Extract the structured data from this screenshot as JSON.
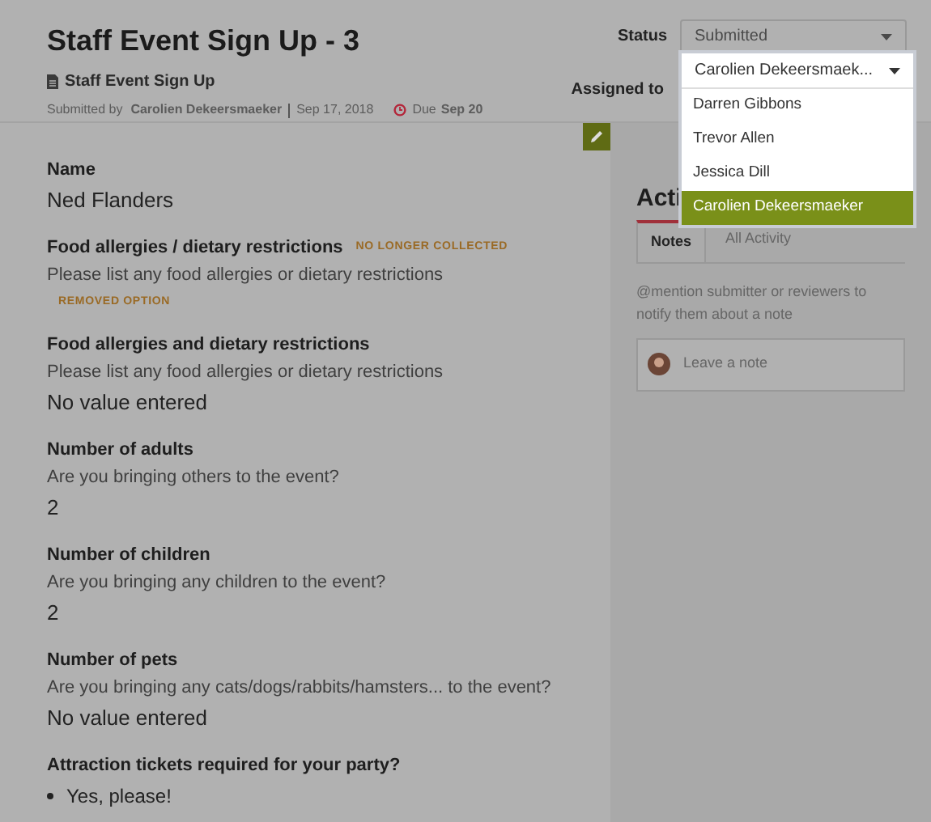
{
  "header": {
    "title": "Staff Event Sign Up - 3",
    "form_name": "Staff Event Sign Up",
    "submitted_by_label": "Submitted by",
    "submitter": "Carolien Dekeersmaeker",
    "date": "Sep 17, 2018",
    "due_label": "Due",
    "due_date": "Sep 20"
  },
  "status": {
    "label": "Status",
    "value": "Submitted"
  },
  "assigned": {
    "label": "Assigned to",
    "value": "Carolien Dekeersmaek...",
    "expanded": true,
    "options": [
      {
        "label": "Darren Gibbons",
        "selected": false
      },
      {
        "label": "Trevor Allen",
        "selected": false
      },
      {
        "label": "Jessica Dill",
        "selected": false
      },
      {
        "label": "Carolien Dekeersmaeker",
        "selected": true
      }
    ]
  },
  "fields": [
    {
      "label": "Name",
      "value": "Ned Flanders",
      "kind": "text"
    },
    {
      "label": "Food allergies / dietary restrictions",
      "badge": "NO LONGER COLLECTED",
      "description": "Please list any food allergies or dietary restrictions",
      "value": "REMOVED OPTION",
      "kind": "removed"
    },
    {
      "label": "Food allergies and dietary restrictions",
      "description": "Please list any food allergies or dietary restrictions",
      "value": "No value entered",
      "kind": "text"
    },
    {
      "label": "Number of adults",
      "description": "Are you bringing others to the event?",
      "value": "2",
      "kind": "text"
    },
    {
      "label": "Number of children",
      "description": "Are you bringing any children to the event?",
      "value": "2",
      "kind": "text"
    },
    {
      "label": "Number of pets",
      "description": "Are you bringing any cats/dogs/rabbits/hamsters... to the event?",
      "value": "No value entered",
      "kind": "text"
    },
    {
      "label": "Attraction tickets required for your party?",
      "value": "Yes, please!",
      "kind": "bullet"
    }
  ],
  "activity": {
    "title": "Acti",
    "tabs": [
      {
        "label": "Notes",
        "selected": true
      },
      {
        "label": "All Activity",
        "selected": false
      }
    ],
    "hint": "@mention submitter or reviewers to notify them about a note",
    "note": {
      "placeholder": "Leave a note"
    }
  }
}
